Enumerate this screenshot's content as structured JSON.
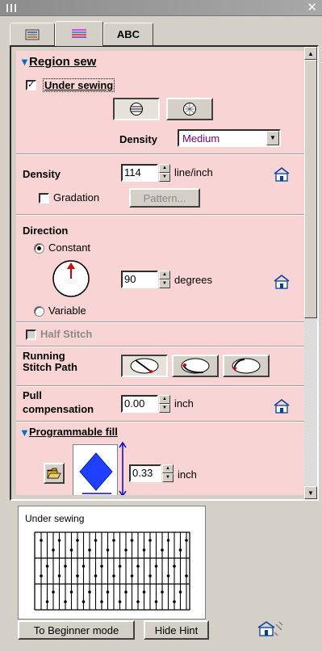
{
  "tabs": {
    "abc_label": "ABC"
  },
  "region_sew": {
    "title": "Region sew",
    "under_sewing_label": "Under sewing",
    "under_sewing_checked": true,
    "density_label": "Density",
    "density_value": "Medium"
  },
  "density_section": {
    "label": "Density",
    "value": "114",
    "unit": "line/inch",
    "gradation_label": "Gradation",
    "pattern_button": "Pattern..."
  },
  "direction": {
    "label": "Direction",
    "constant_label": "Constant",
    "variable_label": "Variable",
    "value": "90",
    "unit": "degrees"
  },
  "half_stitch_label": "Half Stitch",
  "running_stitch_label_1": "Running",
  "running_stitch_label_2": "Stitch Path",
  "pull_comp": {
    "label_1": "Pull",
    "label_2": "compensation",
    "value": "0.00",
    "unit": "inch"
  },
  "programmable_fill": {
    "title": "Programmable fill",
    "value": "0.33",
    "unit": "inch"
  },
  "hint": {
    "title": "Under sewing"
  },
  "bottom": {
    "beginner_button": "To Beginner mode",
    "hide_hint_button": "Hide Hint"
  },
  "colors": {
    "panel_pink": "#f8d4d4",
    "accent_blue": "#0070d0",
    "dropdown_text": "#7a006e"
  },
  "icons": [
    "grip-icon",
    "close-icon",
    "stitch-tab-icon",
    "color-tab-icon",
    "home-icon",
    "folder-open-icon",
    "diamond-pattern-icon",
    "help-home-icon"
  ]
}
